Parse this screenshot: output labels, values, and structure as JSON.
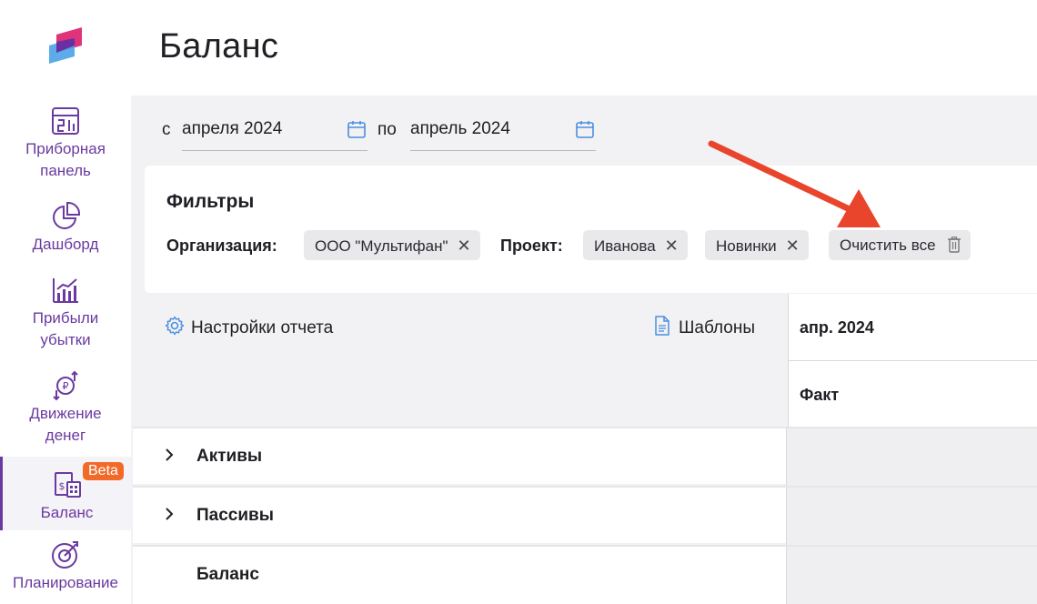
{
  "sidebar": {
    "items": [
      {
        "label": "Приборная панель",
        "icon": "dashboard-panel-icon"
      },
      {
        "label": "Дашборд",
        "icon": "pie-chart-icon"
      },
      {
        "label": "Прибыли убытки",
        "icon": "bar-chart-icon"
      },
      {
        "label": "Движение денег",
        "icon": "money-flow-icon"
      },
      {
        "label": "Баланс",
        "icon": "balance-icon",
        "badge": "Beta",
        "active": true
      },
      {
        "label": "Планирование",
        "icon": "target-icon"
      }
    ]
  },
  "page": {
    "title": "Баланс"
  },
  "date_range": {
    "from_prefix": "с",
    "from_value": "апреля 2024",
    "to_prefix": "по",
    "to_value": "апрель 2024"
  },
  "filters": {
    "title": "Фильтры",
    "organization_label": "Организация:",
    "organization_chips": [
      "ООО \"Мультифан\""
    ],
    "project_label": "Проект:",
    "project_chips": [
      "Иванова",
      "Новинки"
    ],
    "clear_all": "Очистить все"
  },
  "report": {
    "settings_label": "Настройки отчета",
    "templates_label": "Шаблоны",
    "period": "апр. 2024",
    "column": "Факт",
    "rows": [
      {
        "label": "Активы",
        "expandable": true
      },
      {
        "label": "Пассивы",
        "expandable": true
      },
      {
        "label": "Баланс",
        "expandable": false
      }
    ]
  },
  "colors": {
    "accent": "#6a3aa0",
    "badge": "#f26a2a",
    "arrow": "#e8452c",
    "panel": "#f2f2f4"
  }
}
